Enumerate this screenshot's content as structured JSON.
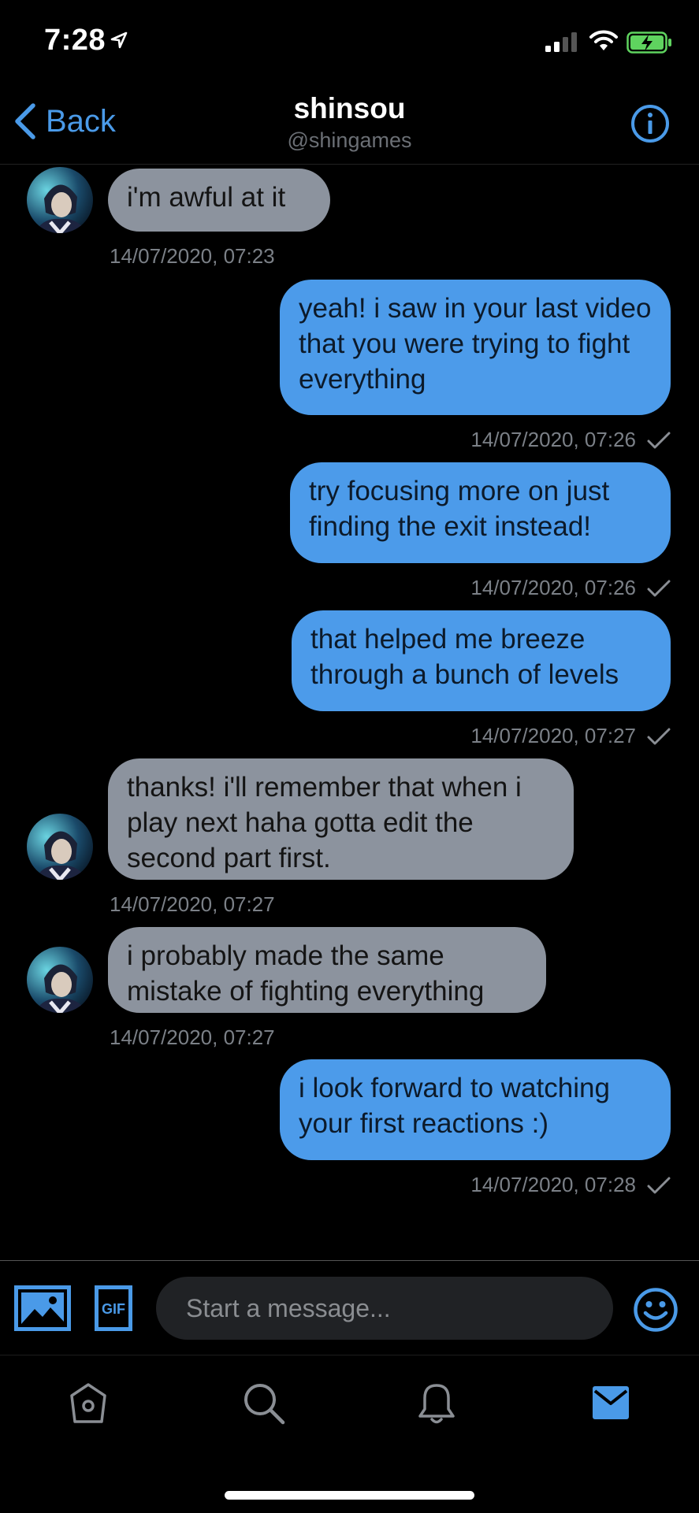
{
  "status_bar": {
    "time": "7:28"
  },
  "header": {
    "back_label": "Back",
    "title": "shinsou",
    "handle": "@shingames"
  },
  "messages": [
    {
      "dir": "in",
      "text": "i'm awful at it",
      "timestamp": "14/07/2020, 07:23"
    },
    {
      "dir": "out",
      "text": "yeah! i saw in your last video that you were trying to fight everything",
      "timestamp": "14/07/2020, 07:26"
    },
    {
      "dir": "out",
      "text": "try focusing more on just finding the exit instead!",
      "timestamp": "14/07/2020, 07:26"
    },
    {
      "dir": "out",
      "text": "that helped me breeze through a bunch of levels",
      "timestamp": "14/07/2020, 07:27"
    },
    {
      "dir": "in",
      "text": "thanks! i'll remember that when i play next haha gotta edit the second part first.",
      "timestamp": "14/07/2020, 07:27"
    },
    {
      "dir": "in",
      "text": "i probably made the same mistake of fighting everything",
      "timestamp": "14/07/2020, 07:27"
    },
    {
      "dir": "out",
      "text": "i look forward to watching your first reactions :)",
      "timestamp": "14/07/2020, 07:28"
    }
  ],
  "composer": {
    "placeholder": "Start a message...",
    "gif_label": "GIF"
  },
  "icons": {
    "back": "chevron-left-icon",
    "info": "info-icon",
    "image": "image-icon",
    "gif": "gif-icon",
    "emoji": "emoji-icon",
    "home": "home-icon",
    "search": "search-icon",
    "bell": "bell-icon",
    "mail": "mail-icon",
    "read_receipt": "checkmark-icon"
  },
  "colors": {
    "accent": "#4c9bea",
    "incoming_bubble": "#8c939e",
    "battery": "#5fd35f"
  }
}
